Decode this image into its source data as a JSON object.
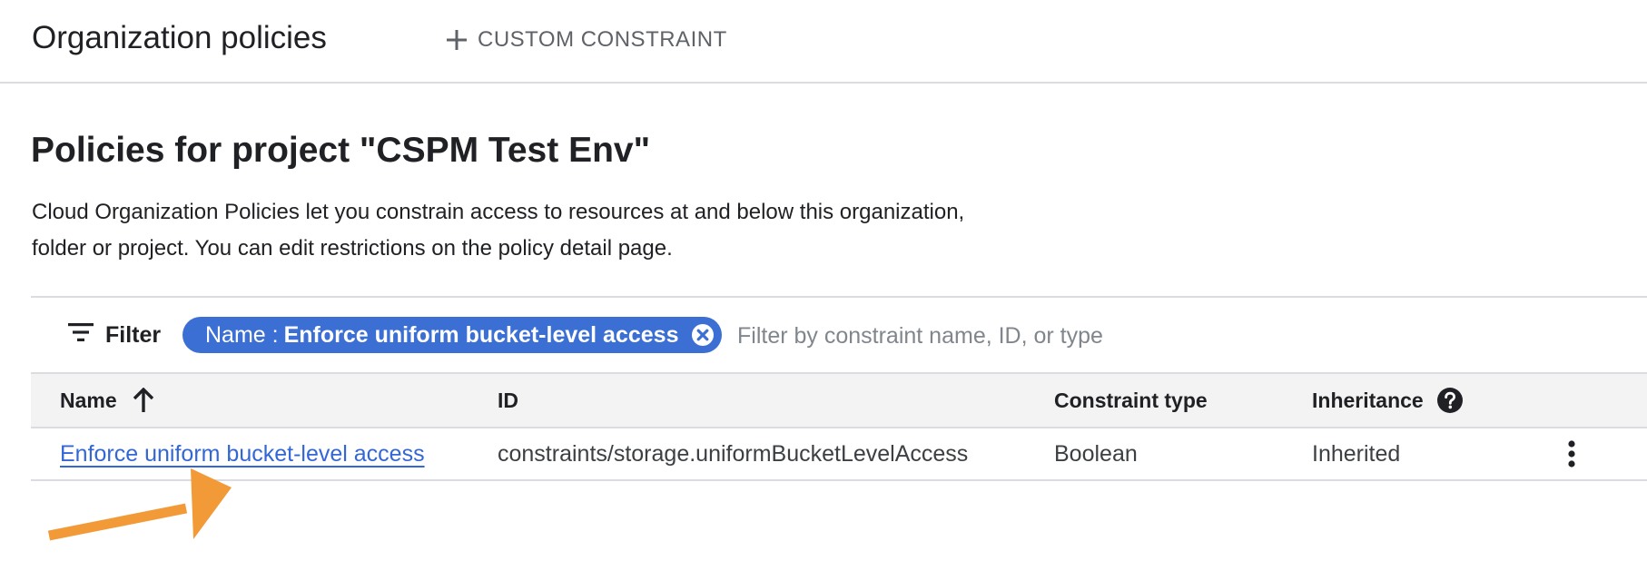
{
  "header": {
    "title": "Organization policies",
    "custom_constraint_label": "CUSTOM CONSTRAINT"
  },
  "main": {
    "heading": "Policies for project \"CSPM Test Env\"",
    "description": "Cloud Organization Policies let you constrain access to resources at and below this organization, folder or project. You can edit restrictions on the policy detail page."
  },
  "filter": {
    "label": "Filter",
    "chip_key": "Name :",
    "chip_value": "Enforce uniform bucket-level access",
    "placeholder": "Filter by constraint name, ID, or type"
  },
  "table": {
    "columns": {
      "name": "Name",
      "id": "ID",
      "constraint_type": "Constraint type",
      "inheritance": "Inheritance"
    },
    "rows": [
      {
        "name": "Enforce uniform bucket-level access",
        "id": "constraints/storage.uniformBucketLevelAccess",
        "constraint_type": "Boolean",
        "inheritance": "Inherited"
      }
    ]
  },
  "icons": {
    "add": "plus-icon",
    "filter": "filter-list-icon",
    "chip_close": "cancel-circle-icon",
    "sort": "arrow-up-icon",
    "help": "help-circle-icon",
    "row_menu": "more-vert-icon",
    "annotation": "arrow-annotation"
  },
  "colors": {
    "link": "#3367d6",
    "chip_bg": "#3b6fd4",
    "annotation_arrow": "#f19a37",
    "header_bg": "#f3f3f3",
    "divider": "#dadce0"
  }
}
